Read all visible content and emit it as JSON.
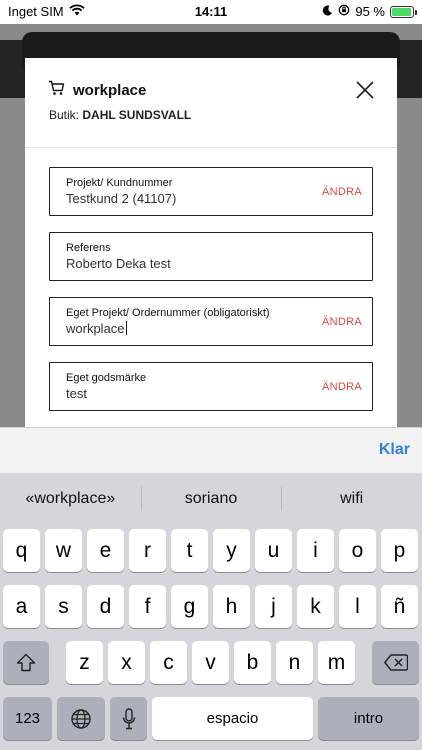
{
  "status_bar": {
    "carrier": "Inget SIM",
    "time": "14:11",
    "battery_percent": "95 %",
    "battery_level": 0.95
  },
  "modal": {
    "title": "workplace",
    "store_label": "Butik:",
    "store_name": "DAHL SUNDSVALL",
    "fields": [
      {
        "label": "Projekt/ Kundnummer",
        "value": "Testkund 2 (41107)",
        "action": "ÄNDRA"
      },
      {
        "label": "Referens",
        "value": "Roberto Deka test"
      },
      {
        "label": "Eget Projekt/ Ordernummer (obligatoriskt)",
        "value": "workplace",
        "action": "ÄNDRA"
      },
      {
        "label": "Eget godsmärke",
        "value": "test",
        "action": "ÄNDRA"
      }
    ]
  },
  "keyboard": {
    "done_label": "Klar",
    "suggestions": [
      "«workplace»",
      "soriano",
      "wifi"
    ],
    "row1": [
      "q",
      "w",
      "e",
      "r",
      "t",
      "y",
      "u",
      "i",
      "o",
      "p"
    ],
    "row2": [
      "a",
      "s",
      "d",
      "f",
      "g",
      "h",
      "j",
      "k",
      "l",
      "ñ"
    ],
    "row3": [
      "z",
      "x",
      "c",
      "v",
      "b",
      "n",
      "m"
    ],
    "numbers_key": "123",
    "space_key": "espacio",
    "return_key": "intro"
  },
  "colors": {
    "accent_red": "#e0443e",
    "done_blue": "#2f7fde",
    "battery_green": "#4cd964"
  }
}
